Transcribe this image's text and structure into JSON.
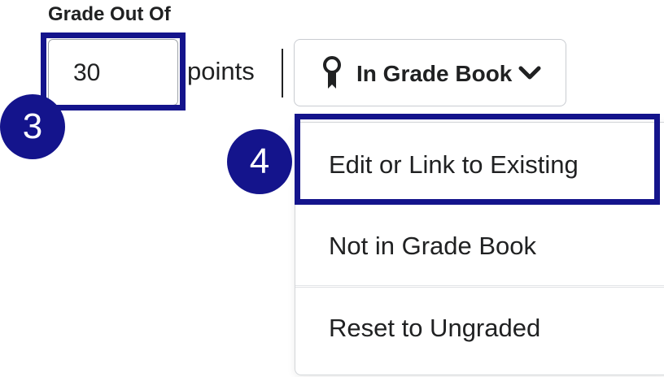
{
  "grade": {
    "label": "Grade Out Of",
    "value": "30",
    "unit": "points"
  },
  "grade_book_button": {
    "icon": "ribbon-icon",
    "label": "In Grade Book",
    "chevron_icon": "chevron-down-icon"
  },
  "menu": {
    "items": [
      {
        "label": "Edit or Link to Existing"
      },
      {
        "label": "Not in Grade Book"
      },
      {
        "label": "Reset to Ungraded"
      }
    ]
  },
  "callouts": {
    "step3": "3",
    "step4": "4"
  },
  "colors": {
    "highlight": "#14148c",
    "text": "#202122",
    "border": "#c9ccd1"
  }
}
